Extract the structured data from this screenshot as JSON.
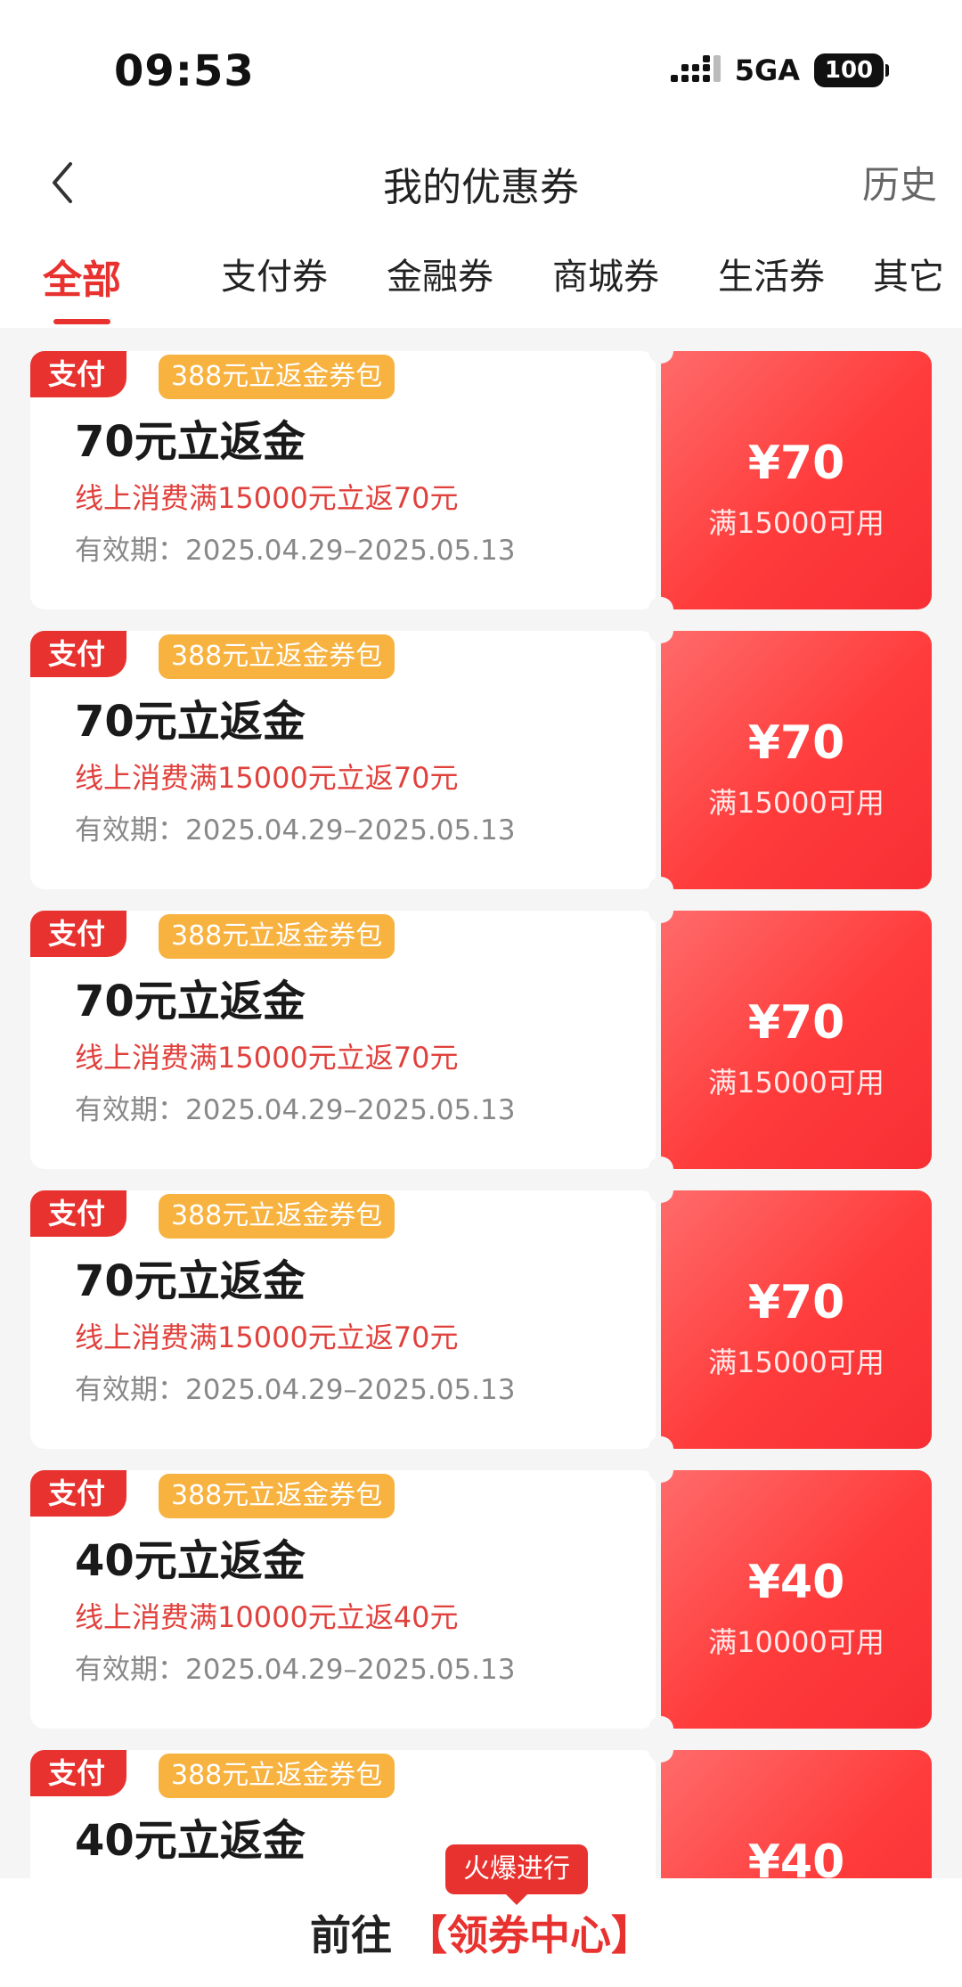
{
  "status_bar": {
    "time": "09:53",
    "network": "5GA",
    "battery": "100"
  },
  "nav": {
    "title": "我的优惠券",
    "history": "历史"
  },
  "tabs": [
    {
      "label": "全部",
      "active": true
    },
    {
      "label": "支付券",
      "active": false
    },
    {
      "label": "金融券",
      "active": false
    },
    {
      "label": "商城券",
      "active": false
    },
    {
      "label": "生活券",
      "active": false
    },
    {
      "label": "其它",
      "active": false
    }
  ],
  "coupons": [
    {
      "tag": "支付",
      "pack": "388元立返金券包",
      "title": "70元立返金",
      "desc": "线上消费满15000元立返70元",
      "validity": "有效期：2025.04.29–2025.05.13",
      "amount": "¥70",
      "threshold": "满15000可用"
    },
    {
      "tag": "支付",
      "pack": "388元立返金券包",
      "title": "70元立返金",
      "desc": "线上消费满15000元立返70元",
      "validity": "有效期：2025.04.29–2025.05.13",
      "amount": "¥70",
      "threshold": "满15000可用"
    },
    {
      "tag": "支付",
      "pack": "388元立返金券包",
      "title": "70元立返金",
      "desc": "线上消费满15000元立返70元",
      "validity": "有效期：2025.04.29–2025.05.13",
      "amount": "¥70",
      "threshold": "满15000可用"
    },
    {
      "tag": "支付",
      "pack": "388元立返金券包",
      "title": "70元立返金",
      "desc": "线上消费满15000元立返70元",
      "validity": "有效期：2025.04.29–2025.05.13",
      "amount": "¥70",
      "threshold": "满15000可用"
    },
    {
      "tag": "支付",
      "pack": "388元立返金券包",
      "title": "40元立返金",
      "desc": "线上消费满10000元立返40元",
      "validity": "有效期：2025.04.29–2025.05.13",
      "amount": "¥40",
      "threshold": "满10000可用"
    },
    {
      "tag": "支付",
      "pack": "388元立返金券包",
      "title": "40元立返金",
      "desc": "",
      "validity": "",
      "amount": "¥40",
      "threshold": ""
    }
  ],
  "bottom": {
    "badge": "火爆进行",
    "go_prefix": "前往",
    "go_center": "【领券中心】"
  },
  "colors": {
    "accent": "#e8322f",
    "pack_tag": "#f7b23f",
    "coupon_gradient_start": "#ff6b6b",
    "coupon_gradient_end": "#f72f35"
  }
}
